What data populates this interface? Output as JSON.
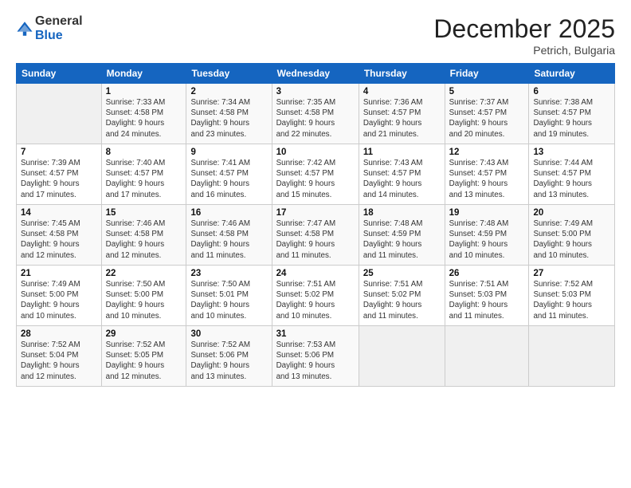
{
  "logo": {
    "general": "General",
    "blue": "Blue"
  },
  "header": {
    "month": "December 2025",
    "location": "Petrich, Bulgaria"
  },
  "weekdays": [
    "Sunday",
    "Monday",
    "Tuesday",
    "Wednesday",
    "Thursday",
    "Friday",
    "Saturday"
  ],
  "weeks": [
    [
      {
        "num": "",
        "info": ""
      },
      {
        "num": "1",
        "info": "Sunrise: 7:33 AM\nSunset: 4:58 PM\nDaylight: 9 hours\nand 24 minutes."
      },
      {
        "num": "2",
        "info": "Sunrise: 7:34 AM\nSunset: 4:58 PM\nDaylight: 9 hours\nand 23 minutes."
      },
      {
        "num": "3",
        "info": "Sunrise: 7:35 AM\nSunset: 4:58 PM\nDaylight: 9 hours\nand 22 minutes."
      },
      {
        "num": "4",
        "info": "Sunrise: 7:36 AM\nSunset: 4:57 PM\nDaylight: 9 hours\nand 21 minutes."
      },
      {
        "num": "5",
        "info": "Sunrise: 7:37 AM\nSunset: 4:57 PM\nDaylight: 9 hours\nand 20 minutes."
      },
      {
        "num": "6",
        "info": "Sunrise: 7:38 AM\nSunset: 4:57 PM\nDaylight: 9 hours\nand 19 minutes."
      }
    ],
    [
      {
        "num": "7",
        "info": "Sunrise: 7:39 AM\nSunset: 4:57 PM\nDaylight: 9 hours\nand 17 minutes."
      },
      {
        "num": "8",
        "info": "Sunrise: 7:40 AM\nSunset: 4:57 PM\nDaylight: 9 hours\nand 17 minutes."
      },
      {
        "num": "9",
        "info": "Sunrise: 7:41 AM\nSunset: 4:57 PM\nDaylight: 9 hours\nand 16 minutes."
      },
      {
        "num": "10",
        "info": "Sunrise: 7:42 AM\nSunset: 4:57 PM\nDaylight: 9 hours\nand 15 minutes."
      },
      {
        "num": "11",
        "info": "Sunrise: 7:43 AM\nSunset: 4:57 PM\nDaylight: 9 hours\nand 14 minutes."
      },
      {
        "num": "12",
        "info": "Sunrise: 7:43 AM\nSunset: 4:57 PM\nDaylight: 9 hours\nand 13 minutes."
      },
      {
        "num": "13",
        "info": "Sunrise: 7:44 AM\nSunset: 4:57 PM\nDaylight: 9 hours\nand 13 minutes."
      }
    ],
    [
      {
        "num": "14",
        "info": "Sunrise: 7:45 AM\nSunset: 4:58 PM\nDaylight: 9 hours\nand 12 minutes."
      },
      {
        "num": "15",
        "info": "Sunrise: 7:46 AM\nSunset: 4:58 PM\nDaylight: 9 hours\nand 12 minutes."
      },
      {
        "num": "16",
        "info": "Sunrise: 7:46 AM\nSunset: 4:58 PM\nDaylight: 9 hours\nand 11 minutes."
      },
      {
        "num": "17",
        "info": "Sunrise: 7:47 AM\nSunset: 4:58 PM\nDaylight: 9 hours\nand 11 minutes."
      },
      {
        "num": "18",
        "info": "Sunrise: 7:48 AM\nSunset: 4:59 PM\nDaylight: 9 hours\nand 11 minutes."
      },
      {
        "num": "19",
        "info": "Sunrise: 7:48 AM\nSunset: 4:59 PM\nDaylight: 9 hours\nand 10 minutes."
      },
      {
        "num": "20",
        "info": "Sunrise: 7:49 AM\nSunset: 5:00 PM\nDaylight: 9 hours\nand 10 minutes."
      }
    ],
    [
      {
        "num": "21",
        "info": "Sunrise: 7:49 AM\nSunset: 5:00 PM\nDaylight: 9 hours\nand 10 minutes."
      },
      {
        "num": "22",
        "info": "Sunrise: 7:50 AM\nSunset: 5:00 PM\nDaylight: 9 hours\nand 10 minutes."
      },
      {
        "num": "23",
        "info": "Sunrise: 7:50 AM\nSunset: 5:01 PM\nDaylight: 9 hours\nand 10 minutes."
      },
      {
        "num": "24",
        "info": "Sunrise: 7:51 AM\nSunset: 5:02 PM\nDaylight: 9 hours\nand 10 minutes."
      },
      {
        "num": "25",
        "info": "Sunrise: 7:51 AM\nSunset: 5:02 PM\nDaylight: 9 hours\nand 11 minutes."
      },
      {
        "num": "26",
        "info": "Sunrise: 7:51 AM\nSunset: 5:03 PM\nDaylight: 9 hours\nand 11 minutes."
      },
      {
        "num": "27",
        "info": "Sunrise: 7:52 AM\nSunset: 5:03 PM\nDaylight: 9 hours\nand 11 minutes."
      }
    ],
    [
      {
        "num": "28",
        "info": "Sunrise: 7:52 AM\nSunset: 5:04 PM\nDaylight: 9 hours\nand 12 minutes."
      },
      {
        "num": "29",
        "info": "Sunrise: 7:52 AM\nSunset: 5:05 PM\nDaylight: 9 hours\nand 12 minutes."
      },
      {
        "num": "30",
        "info": "Sunrise: 7:52 AM\nSunset: 5:06 PM\nDaylight: 9 hours\nand 13 minutes."
      },
      {
        "num": "31",
        "info": "Sunrise: 7:53 AM\nSunset: 5:06 PM\nDaylight: 9 hours\nand 13 minutes."
      },
      {
        "num": "",
        "info": ""
      },
      {
        "num": "",
        "info": ""
      },
      {
        "num": "",
        "info": ""
      }
    ]
  ]
}
